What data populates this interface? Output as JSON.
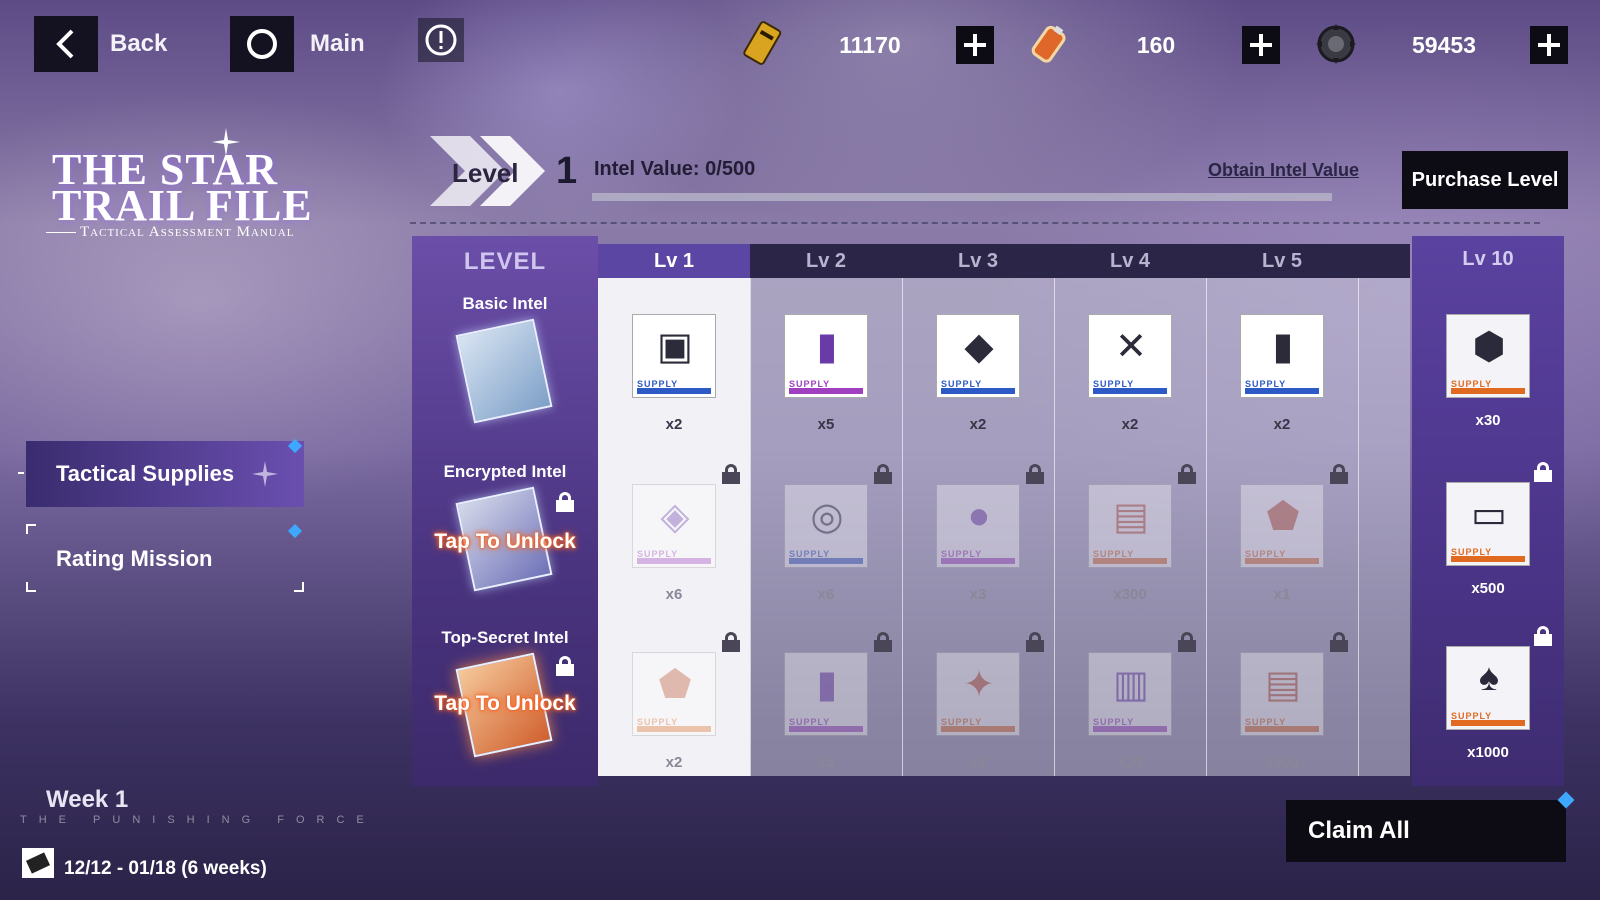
{
  "topbar": {
    "back_label": "Back",
    "main_label": "Main",
    "resources": [
      {
        "icon": "ticket-icon",
        "value": "11170"
      },
      {
        "icon": "battery-icon",
        "value": "160"
      },
      {
        "icon": "gear-coin-icon",
        "value": "59453"
      }
    ]
  },
  "title": {
    "line1": "THE STAR",
    "line2": "TRAIL FILE",
    "subtitle": "Tactical Assessment Manual"
  },
  "level_header": {
    "level_word": "Level",
    "level_num": "1",
    "intel_label": "Intel Value: 0/500",
    "intel_progress": 0,
    "obtain_label": "Obtain Intel Value",
    "purchase_label": "Purchase Level"
  },
  "nav": {
    "items": [
      {
        "label": "Tactical Supplies",
        "active": true
      },
      {
        "label": "Rating Mission",
        "active": false
      }
    ]
  },
  "level_panel": {
    "header": "LEVEL",
    "tiers": [
      {
        "label": "Basic Intel",
        "unlock": ""
      },
      {
        "label": "Encrypted Intel",
        "unlock": "Tap To Unlock"
      },
      {
        "label": "Top-Secret Intel",
        "unlock": "Tap To Unlock"
      }
    ]
  },
  "columns": [
    {
      "label": "Lv 1",
      "items": [
        {
          "qty": "x2",
          "tag": "SUPPLY",
          "color": "blue",
          "icon": "chip-box-icon"
        },
        {
          "qty": "x6",
          "tag": "SUPPLY",
          "color": "purple",
          "icon": "processor-icon"
        },
        {
          "qty": "x2",
          "tag": "SUPPLY",
          "color": "orange",
          "icon": "armor-icon"
        }
      ]
    },
    {
      "label": "Lv 2",
      "items": [
        {
          "qty": "x5",
          "tag": "SUPPLY",
          "color": "purple",
          "icon": "canister-icon"
        },
        {
          "qty": "x6",
          "tag": "SUPPLY",
          "color": "blue",
          "icon": "coil-icon"
        },
        {
          "qty": "x5",
          "tag": "SUPPLY",
          "color": "purple",
          "icon": "canister-icon"
        }
      ]
    },
    {
      "label": "Lv 3",
      "items": [
        {
          "qty": "x2",
          "tag": "SUPPLY",
          "color": "blue",
          "icon": "crystal-icon"
        },
        {
          "qty": "x3",
          "tag": "SUPPLY",
          "color": "purple",
          "icon": "orb-icon"
        },
        {
          "qty": "x2",
          "tag": "SUPPLY",
          "color": "orange",
          "icon": "gift-icon"
        }
      ]
    },
    {
      "label": "Lv 4",
      "items": [
        {
          "qty": "x2",
          "tag": "SUPPLY",
          "color": "blue",
          "icon": "tool-icon"
        },
        {
          "qty": "x300",
          "tag": "SUPPLY",
          "color": "orange",
          "icon": "document-icon"
        },
        {
          "qty": "x20",
          "tag": "SUPPLY",
          "color": "purple",
          "icon": "book-icon"
        }
      ]
    },
    {
      "label": "Lv 5",
      "items": [
        {
          "qty": "x2",
          "tag": "SUPPLY",
          "color": "blue",
          "icon": "canister-icon"
        },
        {
          "qty": "x1",
          "tag": "SUPPLY",
          "color": "orange",
          "icon": "armor-icon"
        },
        {
          "qty": "x900",
          "tag": "SUPPLY",
          "color": "orange",
          "icon": "document-icon"
        }
      ]
    }
  ],
  "lv10": {
    "label": "Lv 10",
    "items": [
      {
        "qty": "x30",
        "tag": "SUPPLY",
        "color": "orange",
        "icon": "mech-icon"
      },
      {
        "qty": "x500",
        "tag": "SUPPLY",
        "color": "orange",
        "icon": "card-icon"
      },
      {
        "qty": "x1000",
        "tag": "SUPPLY",
        "color": "orange",
        "icon": "character-card-icon"
      }
    ]
  },
  "footer": {
    "claim_label": "Claim All",
    "week_label": "Week 1",
    "brand_text": "THE PUNISHING FORCE",
    "dates": "12/12 - 01/18 (6 weeks)"
  },
  "colors": {
    "accent_purple": "#5b46a4",
    "dark_button": "#0d0c14",
    "supply_blue": "#2d5ac4",
    "supply_purple": "#a040c0",
    "supply_orange": "#e06a20"
  }
}
